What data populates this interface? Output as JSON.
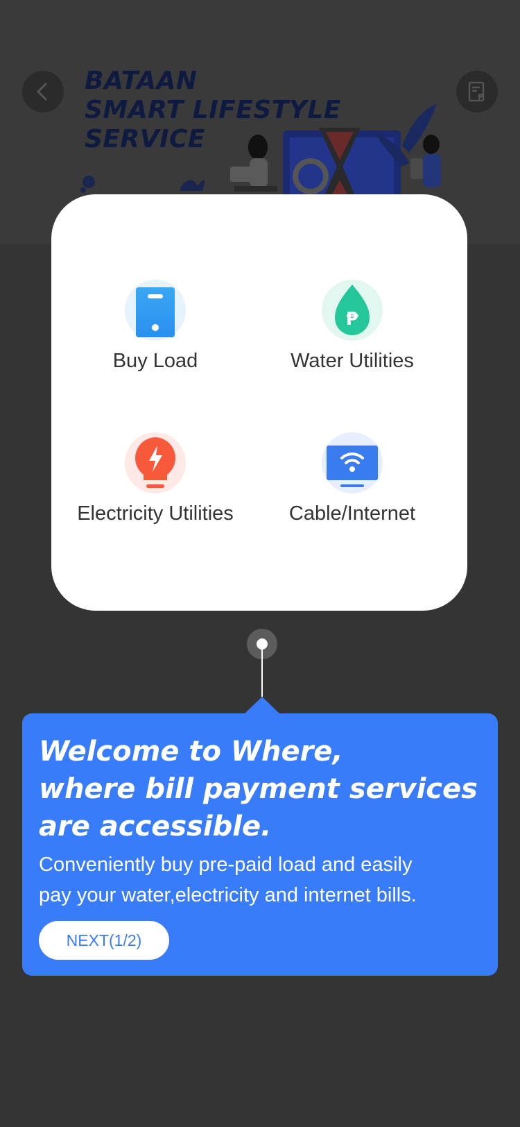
{
  "banner": {
    "title_lines": [
      "BATAAN",
      "SMART LIFESTYLE",
      "SERVICE"
    ]
  },
  "services": [
    {
      "label": "Buy Load",
      "icon": "phone-icon",
      "color": "#2f9cf2"
    },
    {
      "label": "Water Utilities",
      "icon": "water-drop-peso-icon",
      "color": "#25c79a"
    },
    {
      "label": "Electricity Utilities",
      "icon": "lightbulb-icon",
      "color": "#f75a3b"
    },
    {
      "label": "Cable/Internet",
      "icon": "wifi-tv-icon",
      "color": "#3b7bf0"
    }
  ],
  "tooltip": {
    "heading_lines": [
      "Welcome to Where,",
      "where bill payment services",
      "are  accessible."
    ],
    "body_lines": [
      "Conveniently buy pre-paid load and easily",
      "pay your water,electricity and internet bills."
    ],
    "next_label": "NEXT(1/2)"
  },
  "colors": {
    "overlay": "#343434",
    "accent": "#397cfa",
    "card": "#ffffff"
  }
}
